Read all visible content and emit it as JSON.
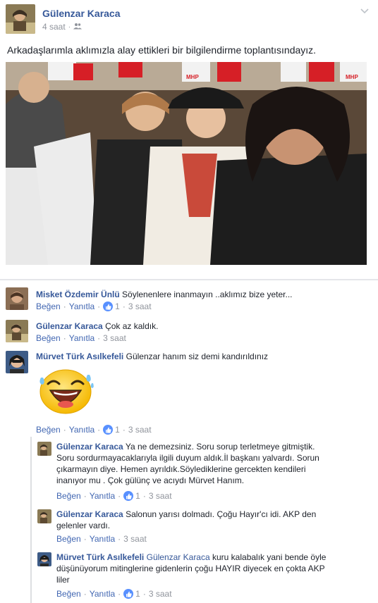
{
  "post": {
    "author": "Gülenzar Karaca",
    "time": "4 saat",
    "audience_icon": "friends-icon",
    "text": "Arkadaşlarımla aklımızla alay ettikleri bir bilgilendirme toplantısındayız.",
    "photo_banner_text": "MHP"
  },
  "comments": [
    {
      "author": "Misket Özdemir Ünlü",
      "text": "Söylenenlere inanmayın ..aklımız bize yeter...",
      "like_label": "Beğen",
      "reply_label": "Yanıtla",
      "likes": "1",
      "time": "3 saat"
    },
    {
      "author": "Gülenzar Karaca",
      "text": "Çok az kaldık.",
      "like_label": "Beğen",
      "reply_label": "Yanıtla",
      "time": "3 saat"
    },
    {
      "author": "Mürvet Türk Asılkefeli",
      "text": "Gülenzar hanım siz demi kandırıldınız",
      "sticker": "laughing-emoji-sticker",
      "like_label": "Beğen",
      "reply_label": "Yanıtla",
      "likes": "1",
      "time": "3 saat"
    }
  ],
  "replies": [
    {
      "author": "Gülenzar Karaca",
      "text_line1": "Ya ne demezsiniz. Soru sorup terletmeye gitmiştik.",
      "text_line2": "Soru sordurmayacaklarıyla ilgili duyum aldık.İl başkanı yalvardı. Sorun",
      "text_line3": "çıkarmayın diye. Hemen ayrıldık.Söylediklerine gercekten kendileri",
      "text_line4": "inanıyor mu . Çok gülünç ve acıydı Mürvet Hanım.",
      "like_label": "Beğen",
      "reply_label": "Yanıtla",
      "likes": "1",
      "time": "3 saat"
    },
    {
      "author": "Gülenzar Karaca",
      "text_line1": "Salonun yarısı dolmadı. Çoğu Hayır'cı idi. AKP den",
      "text_line2": "gelenler vardı.",
      "like_label": "Beğen",
      "reply_label": "Yanıtla",
      "time": "3 saat"
    },
    {
      "author": "Mürvet Türk Asılkefeli",
      "tag": "Gülenzar Karaca",
      "text_line1": "kuru kalabalık yani bende öyle",
      "text_line2": "düşünüyorum mitinglerine gidenlerin çoğu HAYIR diyecek en çokta AKP",
      "text_line3": "liler",
      "like_label": "Beğen",
      "reply_label": "Yanıtla",
      "likes": "1",
      "time": "3 saat"
    }
  ],
  "colors": {
    "link_blue": "#365899",
    "action_blue": "#4267b2",
    "meta_gray": "#90949c",
    "like_blue": "#5890ff",
    "mhp_red": "#d61f26"
  }
}
